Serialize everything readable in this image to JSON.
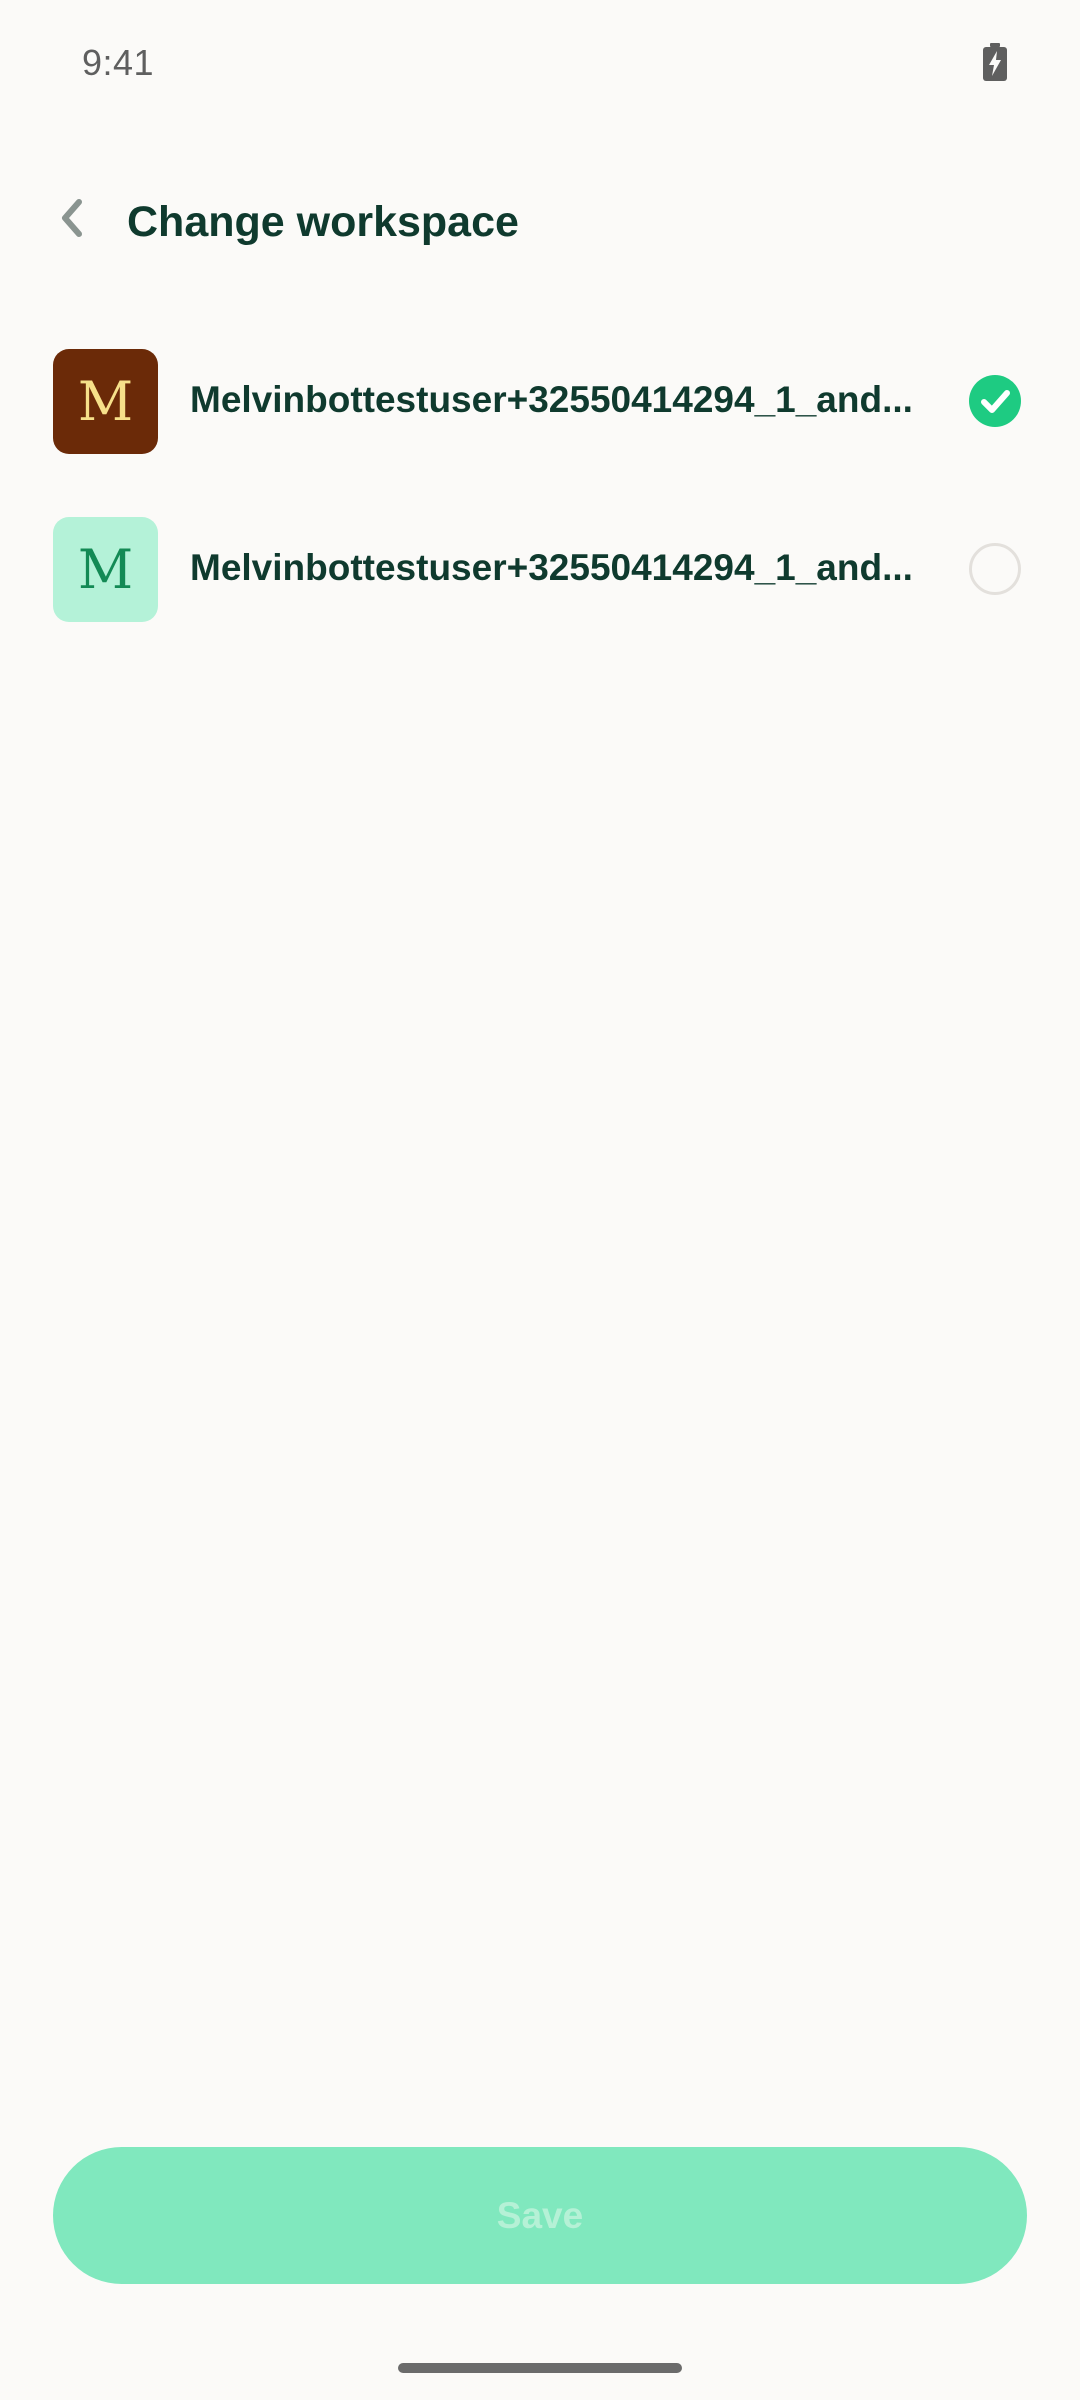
{
  "status_bar": {
    "time": "9:41",
    "battery_icon": "battery-charging-icon"
  },
  "header": {
    "back_icon": "chevron-left-icon",
    "title": "Change workspace"
  },
  "workspaces": [
    {
      "initial": "M",
      "name": "Melvinbottestuser+32550414294_1_and...",
      "avatar_bg": "#6B2A08",
      "avatar_fg": "#F6E08A",
      "selected": true
    },
    {
      "initial": "M",
      "name": "Melvinbottestuser+32550414294_1_and...",
      "avatar_bg": "#B4F2D8",
      "avatar_fg": "#138A55",
      "selected": false
    }
  ],
  "save_label": "Save",
  "colors": {
    "accent": "#1ECB82",
    "save_bg": "#80E8BE",
    "title": "#0F3A2E"
  }
}
